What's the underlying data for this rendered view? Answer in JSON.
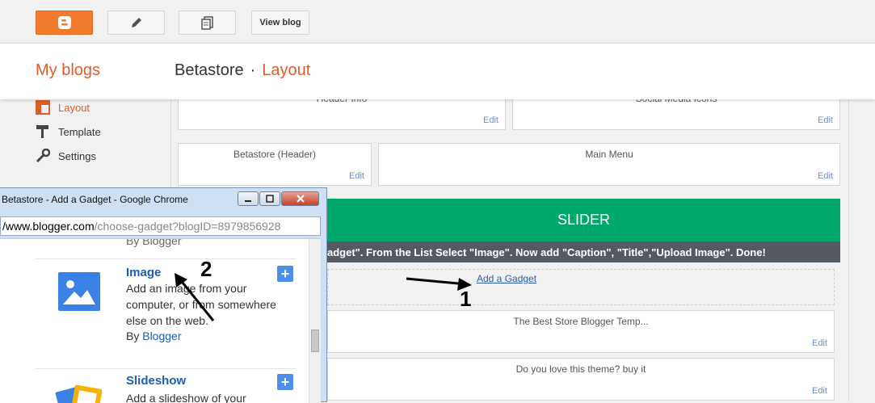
{
  "toolbar": {
    "blogger_icon": "blogger-logo-icon",
    "pencil_icon": "pencil-icon",
    "posts_icon": "pages-icon",
    "view_blog_label": "View blog"
  },
  "header": {
    "my_blogs": "My blogs",
    "blog_name": "Betastore",
    "separator": "·",
    "section": "Layout"
  },
  "sidebar": {
    "items": [
      {
        "label": "Layout",
        "icon": "layout-icon"
      },
      {
        "label": "Template",
        "icon": "paint-roller-icon"
      },
      {
        "label": "Settings",
        "icon": "wrench-icon"
      }
    ]
  },
  "layout": {
    "header_info": {
      "title": "Header Info",
      "edit": "Edit"
    },
    "social_media": {
      "title": "Social Media Icons",
      "edit": "Edit"
    },
    "betastore_header": {
      "title": "Betastore (Header)",
      "edit": "Edit"
    },
    "main_menu": {
      "title": "Main Menu",
      "edit": "Edit"
    },
    "slider_title": "SLIDER",
    "slider_instructions": "adget\". From the List Select \"Image\". Now add \"Caption\", \"Title\",\"Upload Image\". Done!",
    "add_gadget": "Add a Gadget",
    "best_store": {
      "title": "The Best Store Blogger Temp...",
      "edit": "Edit"
    },
    "love_theme": {
      "title": "Do you love this theme? buy it",
      "edit": "Edit"
    }
  },
  "popup": {
    "title": "Betastore - Add a Gadget - Google Chrome",
    "url_host": "/www.blogger.com",
    "url_path": "/choose-gadget?blogID=8979856928",
    "partial_by": "By Blogger",
    "gadgets": [
      {
        "name": "Image",
        "description": "Add an image from your computer, or from somewhere else on the web.",
        "by_prefix": "By ",
        "by_author": "Blogger",
        "add": "+"
      },
      {
        "name": "Slideshow",
        "description": "Add a slideshow of your",
        "add": "+"
      }
    ]
  },
  "annotations": {
    "step1": "1",
    "step2": "2"
  },
  "colors": {
    "accent_orange": "#dd5d28",
    "slider_green": "#00a86b",
    "link_blue": "#1a5fb4"
  }
}
